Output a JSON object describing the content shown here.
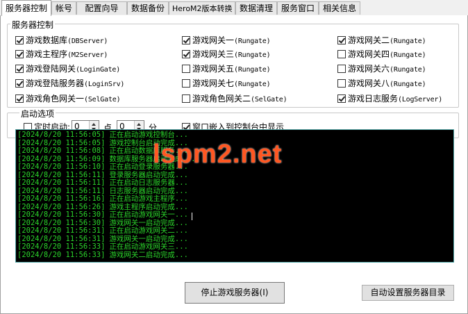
{
  "tabs": [
    {
      "label": "服务器控制",
      "active": true
    },
    {
      "label": "帐号"
    },
    {
      "label": "配置向导"
    },
    {
      "label": "数据备份"
    },
    {
      "label": "HeroM2版本转换"
    },
    {
      "label": "数据清理"
    },
    {
      "label": "服务窗口"
    },
    {
      "label": "相关信息"
    }
  ],
  "server_group": {
    "legend": "服务器控制",
    "items": [
      {
        "cn": "游戏数据库",
        "en": "(DBServer)",
        "checked": true
      },
      {
        "cn": "游戏网关一",
        "en": "(Rungate)",
        "checked": true
      },
      {
        "cn": "游戏网关二",
        "en": "(Rungate)",
        "checked": true
      },
      {
        "cn": "游戏主程序",
        "en": "(M2Server)",
        "checked": true
      },
      {
        "cn": "游戏网关三",
        "en": "(Rungate)",
        "checked": true
      },
      {
        "cn": "游戏网关四",
        "en": "(Rungate)",
        "checked": false
      },
      {
        "cn": "游戏登陆网关",
        "en": "(LoginGate)",
        "checked": true
      },
      {
        "cn": "游戏网关五",
        "en": "(Rungate)",
        "checked": false
      },
      {
        "cn": "游戏网关六",
        "en": "(Rungate)",
        "checked": false
      },
      {
        "cn": "游戏登陆服务器",
        "en": "(LoginSrv)",
        "checked": true
      },
      {
        "cn": "游戏网关七",
        "en": "(Rungate)",
        "checked": false
      },
      {
        "cn": "游戏网关八",
        "en": "(Rungate)",
        "checked": false
      },
      {
        "cn": "游戏角色网关一",
        "en": "(SelGate)",
        "checked": true
      },
      {
        "cn": "游戏角色网关二",
        "en": "(SelGate)",
        "checked": false
      },
      {
        "cn": "游戏日志服务",
        "en": "(LogServer)",
        "checked": true
      }
    ]
  },
  "startup_group": {
    "legend": "启动选项",
    "timed_start_label": "定时启动:",
    "timed_start_checked": false,
    "hour_value": "0",
    "hour_unit": "点",
    "minute_value": "0",
    "minute_unit": "分",
    "embed_label": "窗口嵌入到控制台中显示",
    "embed_checked": true
  },
  "log": [
    {
      "ts": "[2024/8/20 11:56:05]",
      "msg": "正在启动游戏控制台..."
    },
    {
      "ts": "[2024/8/20 11:56:05]",
      "msg": "游戏控制台启动完成..."
    },
    {
      "ts": "[2024/8/20 11:56:08]",
      "msg": "正在启动数据库服务..."
    },
    {
      "ts": "[2024/8/20 11:56:09]",
      "msg": "数据库服务器启动完成..."
    },
    {
      "ts": "[2024/8/20 11:56:10]",
      "msg": "正在启动登录服务器..."
    },
    {
      "ts": "[2024/8/20 11:56:11]",
      "msg": "登录服务器启动完成..."
    },
    {
      "ts": "[2024/8/20 11:56:11]",
      "msg": "正在启动日志服务器..."
    },
    {
      "ts": "[2024/8/20 11:56:11]",
      "msg": "日志服务器启动完成..."
    },
    {
      "ts": "[2024/8/20 11:56:16]",
      "msg": "正在启动游戏主程序..."
    },
    {
      "ts": "[2024/8/20 11:56:26]",
      "msg": "游戏主程序启动完成..."
    },
    {
      "ts": "[2024/8/20 11:56:30]",
      "msg": "正在启动游戏网关一..."
    },
    {
      "ts": "[2024/8/20 11:56:30]",
      "msg": "游戏网关一启动完成..."
    },
    {
      "ts": "[2024/8/20 11:56:31]",
      "msg": "正在启动游戏网关二..."
    },
    {
      "ts": "[2024/8/20 11:56:31]",
      "msg": "游戏网关一启动完成..."
    },
    {
      "ts": "[2024/8/20 11:56:33]",
      "msg": "正在启动游戏网关三..."
    },
    {
      "ts": "[2024/8/20 11:56:33]",
      "msg": "游戏网关二启动完成..."
    }
  ],
  "watermark": "lspm2.net",
  "buttons": {
    "stop_label": "停止游戏服务器(I)",
    "auto_dir_label": "自动设置服务器目录"
  },
  "colors": {
    "console_bg": "#000000",
    "console_text": "#2bd52b",
    "watermark": "#ff5722"
  }
}
